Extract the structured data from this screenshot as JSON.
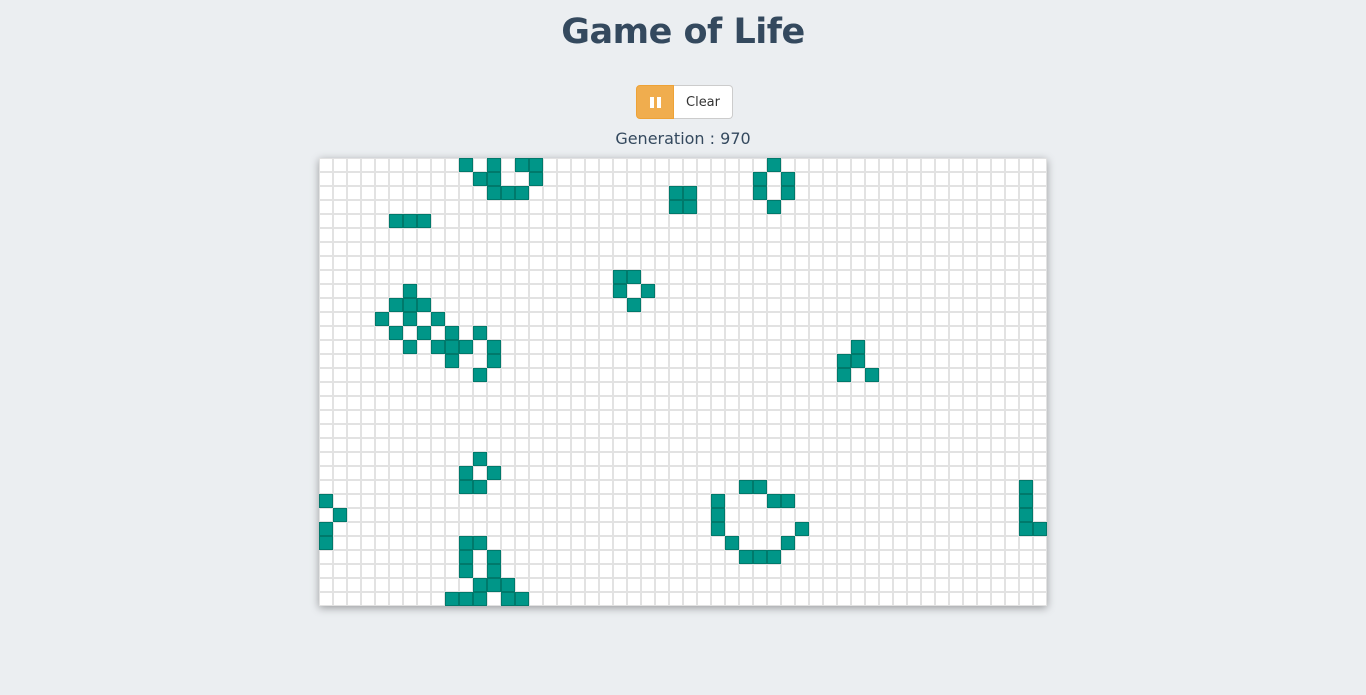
{
  "title": "Game of Life",
  "controls": {
    "pause_icon": "pause-icon",
    "clear_label": "Clear"
  },
  "status": {
    "generation_text": "Generation : 970",
    "generation": 970
  },
  "board": {
    "cols": 52,
    "rows": 32,
    "alive_color": "#009688",
    "dead_color": "#ffffff",
    "grid_color": "#e2e2e2",
    "live_cells": [
      [
        10,
        0
      ],
      [
        12,
        0
      ],
      [
        14,
        0
      ],
      [
        15,
        0
      ],
      [
        11,
        1
      ],
      [
        12,
        1
      ],
      [
        15,
        1
      ],
      [
        12,
        2
      ],
      [
        13,
        2
      ],
      [
        14,
        2
      ],
      [
        25,
        2
      ],
      [
        26,
        2
      ],
      [
        25,
        3
      ],
      [
        26,
        3
      ],
      [
        32,
        0
      ],
      [
        31,
        1
      ],
      [
        33,
        1
      ],
      [
        31,
        2
      ],
      [
        33,
        2
      ],
      [
        32,
        3
      ],
      [
        5,
        4
      ],
      [
        6,
        4
      ],
      [
        7,
        4
      ],
      [
        21,
        8
      ],
      [
        22,
        8
      ],
      [
        21,
        9
      ],
      [
        23,
        9
      ],
      [
        22,
        10
      ],
      [
        6,
        9
      ],
      [
        5,
        10
      ],
      [
        6,
        10
      ],
      [
        7,
        10
      ],
      [
        4,
        11
      ],
      [
        6,
        11
      ],
      [
        8,
        11
      ],
      [
        5,
        12
      ],
      [
        7,
        12
      ],
      [
        9,
        12
      ],
      [
        11,
        12
      ],
      [
        6,
        13
      ],
      [
        8,
        13
      ],
      [
        9,
        13
      ],
      [
        10,
        13
      ],
      [
        12,
        13
      ],
      [
        9,
        14
      ],
      [
        12,
        14
      ],
      [
        11,
        15
      ],
      [
        38,
        13
      ],
      [
        37,
        14
      ],
      [
        38,
        14
      ],
      [
        37,
        15
      ],
      [
        39,
        15
      ],
      [
        11,
        21
      ],
      [
        10,
        22
      ],
      [
        12,
        22
      ],
      [
        10,
        23
      ],
      [
        11,
        23
      ],
      [
        0,
        24
      ],
      [
        1,
        25
      ],
      [
        0,
        26
      ],
      [
        0,
        27
      ],
      [
        30,
        23
      ],
      [
        31,
        23
      ],
      [
        28,
        24
      ],
      [
        32,
        24
      ],
      [
        33,
        24
      ],
      [
        28,
        25
      ],
      [
        28,
        26
      ],
      [
        34,
        26
      ],
      [
        29,
        27
      ],
      [
        33,
        27
      ],
      [
        30,
        28
      ],
      [
        31,
        28
      ],
      [
        32,
        28
      ],
      [
        50,
        23
      ],
      [
        50,
        24
      ],
      [
        50,
        25
      ],
      [
        50,
        26
      ],
      [
        51,
        26
      ],
      [
        10,
        27
      ],
      [
        11,
        27
      ],
      [
        10,
        28
      ],
      [
        12,
        28
      ],
      [
        10,
        29
      ],
      [
        12,
        29
      ],
      [
        11,
        30
      ],
      [
        12,
        30
      ],
      [
        13,
        30
      ],
      [
        9,
        31
      ],
      [
        10,
        31
      ],
      [
        11,
        31
      ],
      [
        13,
        31
      ],
      [
        14,
        31
      ]
    ]
  }
}
